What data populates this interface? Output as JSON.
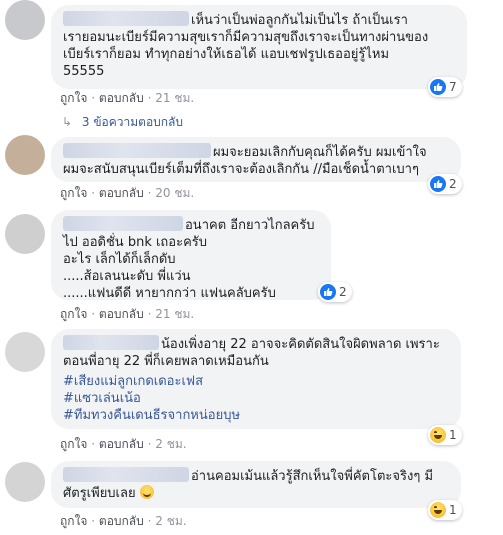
{
  "comments": [
    {
      "lines": [
        "เห็นว่าเป็นพ่อลูกกันไม่เป็นไร ถ้าเป็นเรา",
        "เรายอมนะเบียร์มีความสุขเราก็มีความสุขถึงเราจะเป็นทางผ่านของ",
        "เบียร์เราก็ยอม ทำทุกอย่างให้เธอได้ แอบเชฟรูปเธออยู่รู้ไหม",
        "55555"
      ],
      "like": "ถูกใจ",
      "reply": "ตอบกลับ",
      "time": "21 ชม.",
      "reaction_count": "7",
      "replies_label": "3 ข้อความตอบกลับ"
    },
    {
      "lines": [
        "ผมจะยอมเลิกกับคุณก็ได้ครับ ผมเข้าใจ",
        "ผมจะสนับสนุนเบียร์เต็มที่ถึงเราจะต้องเลิกกัน //มือเช็ดน้ำตาเบาๆ"
      ],
      "like": "ถูกใจ",
      "reply": "ตอบกลับ",
      "time": "20 ชม.",
      "reaction_count": "2"
    },
    {
      "lines": [
        "อนาคต อีกยาวไกลครับ",
        "ไป ออดิชั่น bnk เถอะครับ",
        "อะไร เล็กได้ก็เล็กดับ",
        ".....ส้อเลนนะดับ พี่แว่น",
        "......แฟนดีดี หายากกว่า แฟนคลับครับ"
      ],
      "like": "ถูกใจ",
      "reply": "ตอบกลับ",
      "time": "21 ชม.",
      "reaction_count": "2"
    },
    {
      "lines": [
        "น้องเพิ่งอายุ 22 อาจจะคิดตัดสินใจผิดพลาด เพราะ",
        "ตอนพี่อายุ 22 พี่ก็เคยพลาดเหมือนกัน"
      ],
      "tags": [
        "#เสียงแม่ลูกเกดเดอะเฟส",
        "#แซวเล่นเน้อ",
        "#ทีมทวงคืนเดนธีรจากหน่อยบุษ"
      ],
      "like": "ถูกใจ",
      "reply": "ตอบกลับ",
      "time": "2 ชม.",
      "reaction_count": "1"
    },
    {
      "lines": [
        "อ่านคอมเม้นแล้วรู้สึกเห็นใจพี่คัตโตะจริงๆ มี",
        "ศัตรูเพียบเลย"
      ],
      "like": "ถูกใจ",
      "reply": "ตอบกลับ",
      "time": "2 ชม.",
      "reaction_count": "1"
    }
  ],
  "separator": "·",
  "colors": {
    "bubble": "#f2f3f5",
    "link": "#385898",
    "like_blue": "#1877f2"
  }
}
